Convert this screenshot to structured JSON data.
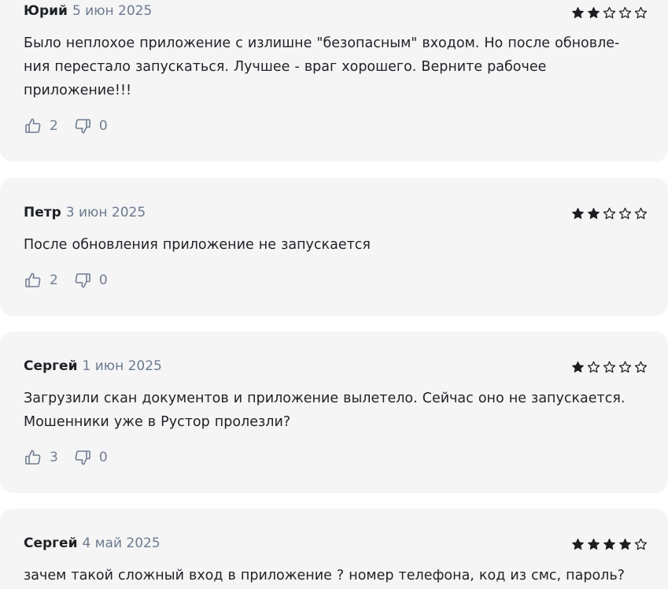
{
  "reviews": [
    {
      "author": "Юрий",
      "date": "5 июн 2025",
      "rating": 2,
      "text": "Было неплохое приложение с излишне \"безопасным\" входом. Но после обновле-\nния перестало запускаться. Лучшее - враг хорошего. Верните рабочее\nприложение!!!",
      "likes": "2",
      "dislikes": "0"
    },
    {
      "author": "Петр",
      "date": "3 июн 2025",
      "rating": 2,
      "text": "После обновления приложение не запускается",
      "likes": "2",
      "dislikes": "0"
    },
    {
      "author": "Сергей",
      "date": "1 июн 2025",
      "rating": 1,
      "text": "Загрузили скан документов и приложение вылетело. Сейчас оно не запускается.\nМошенники уже в Рустор пролезли?",
      "likes": "3",
      "dislikes": "0"
    },
    {
      "author": "Сергей",
      "date": "4 май 2025",
      "rating": 4,
      "text": "зачем такой сложный вход в приложение ? номер телефона, код из смс, пароль?",
      "likes": "",
      "dislikes": ""
    }
  ],
  "rating_max": 5,
  "icons": {
    "like": "thumbs-up-icon",
    "dislike": "thumbs-down-icon",
    "star_filled": "star-filled-icon",
    "star_empty": "star-outline-icon"
  },
  "colors": {
    "card_background": "#f5f5f6",
    "author": "#1d2024",
    "date": "#6c7a8e",
    "vote": "#707d90",
    "star": "#1b1d20"
  }
}
